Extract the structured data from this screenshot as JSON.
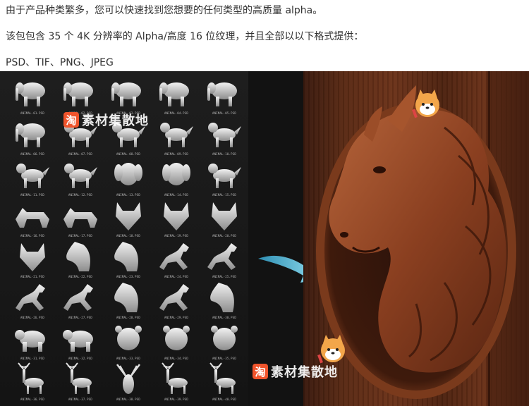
{
  "text": {
    "line1": "由于产品种类繁多，您可以快速找到您想要的任何类型的高质量 alpha。",
    "line2": "该包包含 35 个 4K 分辨率的 Alpha/高度 16 位纹理，并且全部以以下格式提供：",
    "line3": "PSD、TIF、PNG、JPEG"
  },
  "watermark": {
    "badge": "淘",
    "text": "素材集散地"
  },
  "grid": {
    "captions": [
      "ANIMAL-01.PSD",
      "ANIMAL-02.PSD",
      "ANIMAL-03.PSD",
      "ANIMAL-04.PSD",
      "ANIMAL-05.PSD",
      "ANIMAL-06.PSD",
      "ANIMAL-07.PSD",
      "ANIMAL-08.PSD",
      "ANIMAL-09.PSD",
      "ANIMAL-10.PSD",
      "ANIMAL-11.PSD",
      "ANIMAL-12.PSD",
      "ANIMAL-13.PSD",
      "ANIMAL-14.PSD",
      "ANIMAL-15.PSD",
      "ANIMAL-16.PSD",
      "ANIMAL-17.PSD",
      "ANIMAL-18.PSD",
      "ANIMAL-19.PSD",
      "ANIMAL-20.PSD",
      "ANIMAL-21.PSD",
      "ANIMAL-22.PSD",
      "ANIMAL-23.PSD",
      "ANIMAL-24.PSD",
      "ANIMAL-25.PSD",
      "ANIMAL-26.PSD",
      "ANIMAL-27.PSD",
      "ANIMAL-28.PSD",
      "ANIMAL-29.PSD",
      "ANIMAL-30.PSD",
      "ANIMAL-31.PSD",
      "ANIMAL-32.PSD",
      "ANIMAL-33.PSD",
      "ANIMAL-34.PSD",
      "ANIMAL-35.PSD",
      "ANIMAL-36.PSD",
      "ANIMAL-37.PSD",
      "ANIMAL-38.PSD",
      "ANIMAL-39.PSD",
      "ANIMAL-40.PSD"
    ],
    "icons": [
      "elephant-icon",
      "elephant-icon",
      "elephant-icon",
      "elephant-icon",
      "elephant-icon",
      "elephant-icon",
      "dog-icon",
      "dog-icon",
      "dog-icon",
      "dog-icon",
      "dog-icon",
      "dog-icon",
      "dog-head-icon",
      "dog-head-icon",
      "dog-icon",
      "wolf-icon",
      "wolf-icon",
      "wolf-head-icon",
      "wolf-head-icon",
      "wolf-head-icon",
      "wolf-head-icon",
      "horse-head-icon",
      "horse-head-icon",
      "horse-icon",
      "horse-icon",
      "horse-icon",
      "horse-icon",
      "horse-head-icon",
      "horse-icon",
      "horse-head-icon",
      "bear-icon",
      "bear-icon",
      "bear-head-icon",
      "bear-head-icon",
      "bear-head-icon",
      "deer-icon",
      "deer-icon",
      "deer-head-icon",
      "deer-icon",
      "deer-icon"
    ]
  },
  "colors": {
    "accent_arrow": "#6fd0ea",
    "wood": "#5a2a14",
    "badge": "#f0542c"
  }
}
